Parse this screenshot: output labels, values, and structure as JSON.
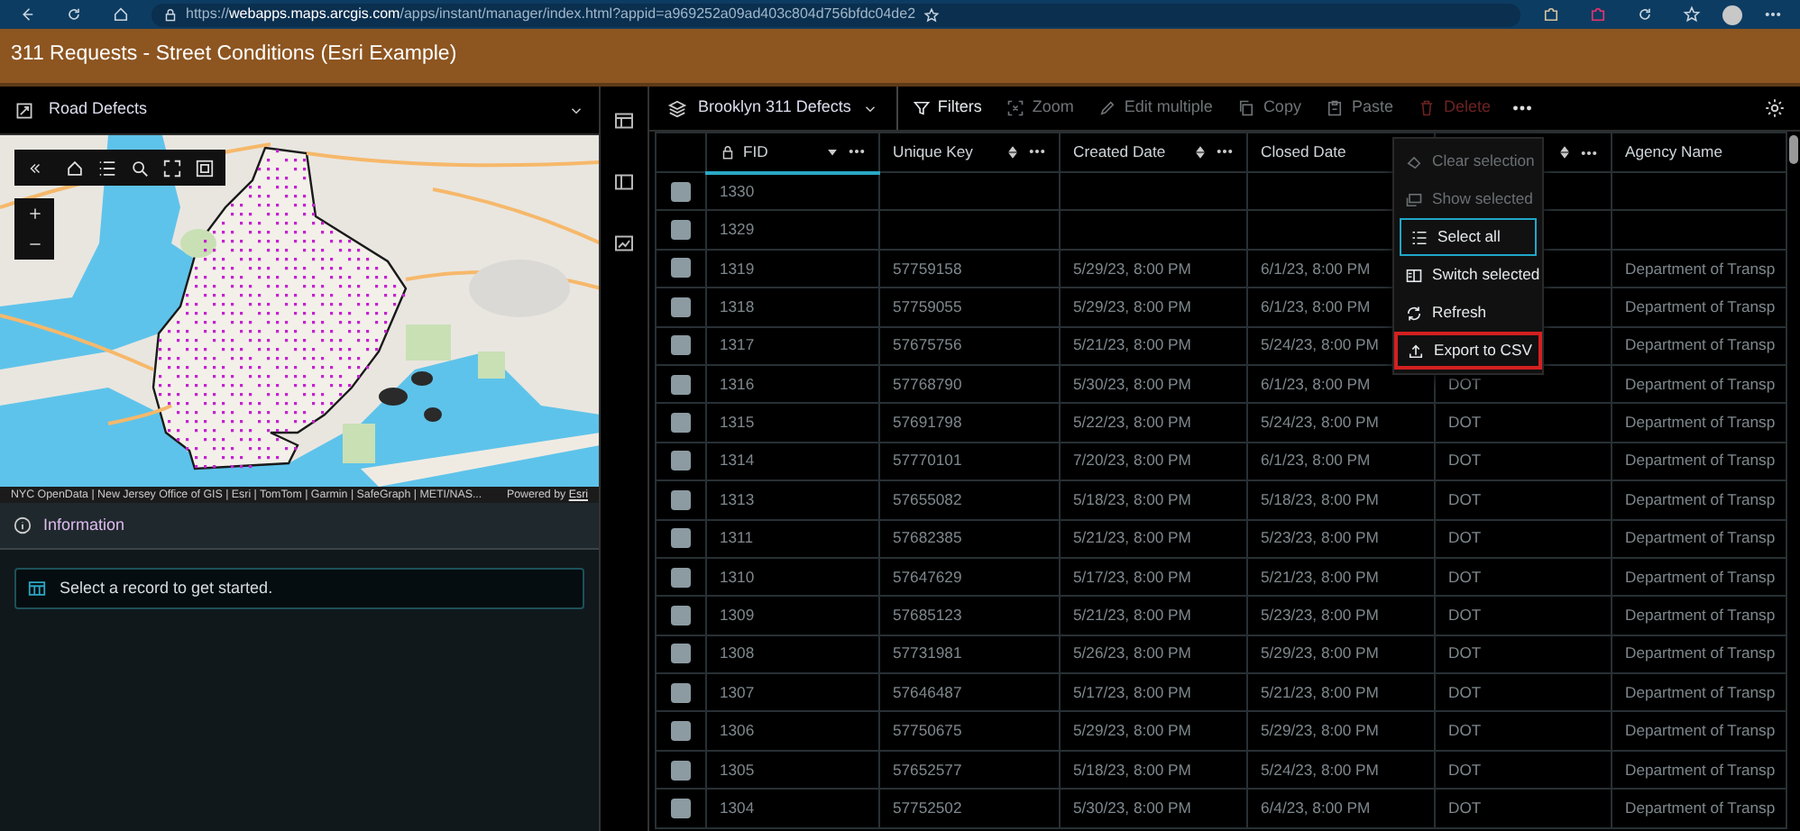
{
  "browser": {
    "url": "https://**webapps.maps.arcgis.com**/apps/instant/manager/index.html?appid=a969252a09ad403c804d756bfdc04de2"
  },
  "app": {
    "title": "311 Requests - Street Conditions (Esri Example)"
  },
  "left_panel": {
    "layer_picker": "Road Defects",
    "map": {
      "kind": "picture",
      "attribution": "NYC OpenData | New Jersey Office of GIS | Esri | TomTom | Garmin | SafeGraph | METI/NAS...",
      "powered_by": "Powered by",
      "powered_link": "Esri"
    },
    "info": {
      "title": "Information",
      "message": "Select a record to get started."
    }
  },
  "toolbar": {
    "layer": "Brooklyn 311 Defects",
    "actions": [
      {
        "kind": "filter",
        "label": "Filters",
        "disabled": false
      },
      {
        "kind": "zoom",
        "label": "Zoom",
        "disabled": true
      },
      {
        "kind": "edit",
        "label": "Edit multiple",
        "disabled": true
      },
      {
        "kind": "copy",
        "label": "Copy",
        "disabled": true
      },
      {
        "kind": "paste",
        "label": "Paste",
        "disabled": true
      },
      {
        "kind": "delete",
        "label": "Delete",
        "disabled": true
      }
    ]
  },
  "table": {
    "columns": [
      {
        "label": "FID",
        "locked": true,
        "sorted": true
      },
      {
        "label": "Unique Key",
        "sorted": false
      },
      {
        "label": "Created Date",
        "sorted": false
      },
      {
        "label": "Closed Date"
      },
      {
        "sorted": false
      },
      {
        "label": "Agency Name"
      }
    ],
    "rows": [
      {
        "checked": false,
        "cells": [
          "1330"
        ]
      },
      {
        "checked": false,
        "cells": [
          "1329"
        ]
      },
      {
        "checked": false,
        "cells": [
          "1319",
          "57759158",
          "5/29/23, 8:00 PM",
          "6/1/23, 8:00 PM",
          null,
          "Department of Transp"
        ]
      },
      {
        "checked": false,
        "cells": [
          "1318",
          "57759055",
          "5/29/23, 8:00 PM",
          "6/1/23, 8:00 PM",
          null,
          "Department of Transp"
        ]
      },
      {
        "checked": false,
        "cells": [
          "1317",
          "57675756",
          "5/21/23, 8:00 PM",
          "5/24/23, 8:00 PM",
          null,
          "Department of Transp"
        ]
      },
      {
        "checked": false,
        "cells": [
          "1316",
          "57768790",
          "5/30/23, 8:00 PM",
          "6/1/23, 8:00 PM",
          "DOT",
          "Department of Transp"
        ]
      },
      {
        "checked": false,
        "cells": [
          "1315",
          "57691798",
          "5/22/23, 8:00 PM",
          "5/24/23, 8:00 PM",
          "DOT",
          "Department of Transp"
        ]
      },
      {
        "checked": false,
        "cells": [
          "1314",
          "57770101",
          "7/20/23, 8:00 PM",
          "6/1/23, 8:00 PM",
          "DOT",
          "Department of Transp"
        ]
      },
      {
        "checked": false,
        "cells": [
          "1313",
          "57655082",
          "5/18/23, 8:00 PM",
          "5/18/23, 8:00 PM",
          "DOT",
          "Department of Transp"
        ]
      },
      {
        "checked": false,
        "cells": [
          "1311",
          "57682385",
          "5/21/23, 8:00 PM",
          "5/23/23, 8:00 PM",
          "DOT",
          "Department of Transp"
        ]
      },
      {
        "checked": false,
        "cells": [
          "1310",
          "57647629",
          "5/17/23, 8:00 PM",
          "5/21/23, 8:00 PM",
          "DOT",
          "Department of Transp"
        ]
      },
      {
        "checked": false,
        "cells": [
          "1309",
          "57685123",
          "5/21/23, 8:00 PM",
          "5/23/23, 8:00 PM",
          "DOT",
          "Department of Transp"
        ]
      },
      {
        "checked": false,
        "cells": [
          "1308",
          "57731981",
          "5/26/23, 8:00 PM",
          "5/29/23, 8:00 PM",
          "DOT",
          "Department of Transp"
        ]
      },
      {
        "checked": false,
        "cells": [
          "1307",
          "57646487",
          "5/17/23, 8:00 PM",
          "5/21/23, 8:00 PM",
          "DOT",
          "Department of Transp"
        ]
      },
      {
        "checked": false,
        "cells": [
          "1306",
          "57750675",
          "5/29/23, 8:00 PM",
          "5/29/23, 8:00 PM",
          "DOT",
          "Department of Transp"
        ]
      },
      {
        "checked": false,
        "cells": [
          "1305",
          "57652577",
          "5/18/23, 8:00 PM",
          "5/24/23, 8:00 PM",
          "DOT",
          "Department of Transp"
        ]
      },
      {
        "checked": false,
        "cells": [
          "1304",
          "57752502",
          "5/30/23, 8:00 PM",
          "6/4/23, 8:00 PM",
          "DOT",
          "Department of Transp"
        ]
      }
    ]
  },
  "menu": {
    "items": [
      {
        "kind": "clear",
        "label": "Clear selection",
        "disabled": true,
        "focused": false,
        "highlighted": false
      },
      {
        "kind": "show",
        "label": "Show selected",
        "disabled": true,
        "focused": false,
        "highlighted": false
      },
      {
        "kind": "select",
        "label": "Select all",
        "disabled": false,
        "focused": true,
        "highlighted": false
      },
      {
        "kind": "switch",
        "label": "Switch selected",
        "disabled": false,
        "focused": false,
        "highlighted": false
      },
      {
        "kind": "refresh",
        "label": "Refresh",
        "disabled": false,
        "focused": false,
        "highlighted": false
      },
      {
        "kind": "export",
        "label": "Export to CSV",
        "disabled": false,
        "focused": false,
        "highlighted": true
      }
    ]
  }
}
